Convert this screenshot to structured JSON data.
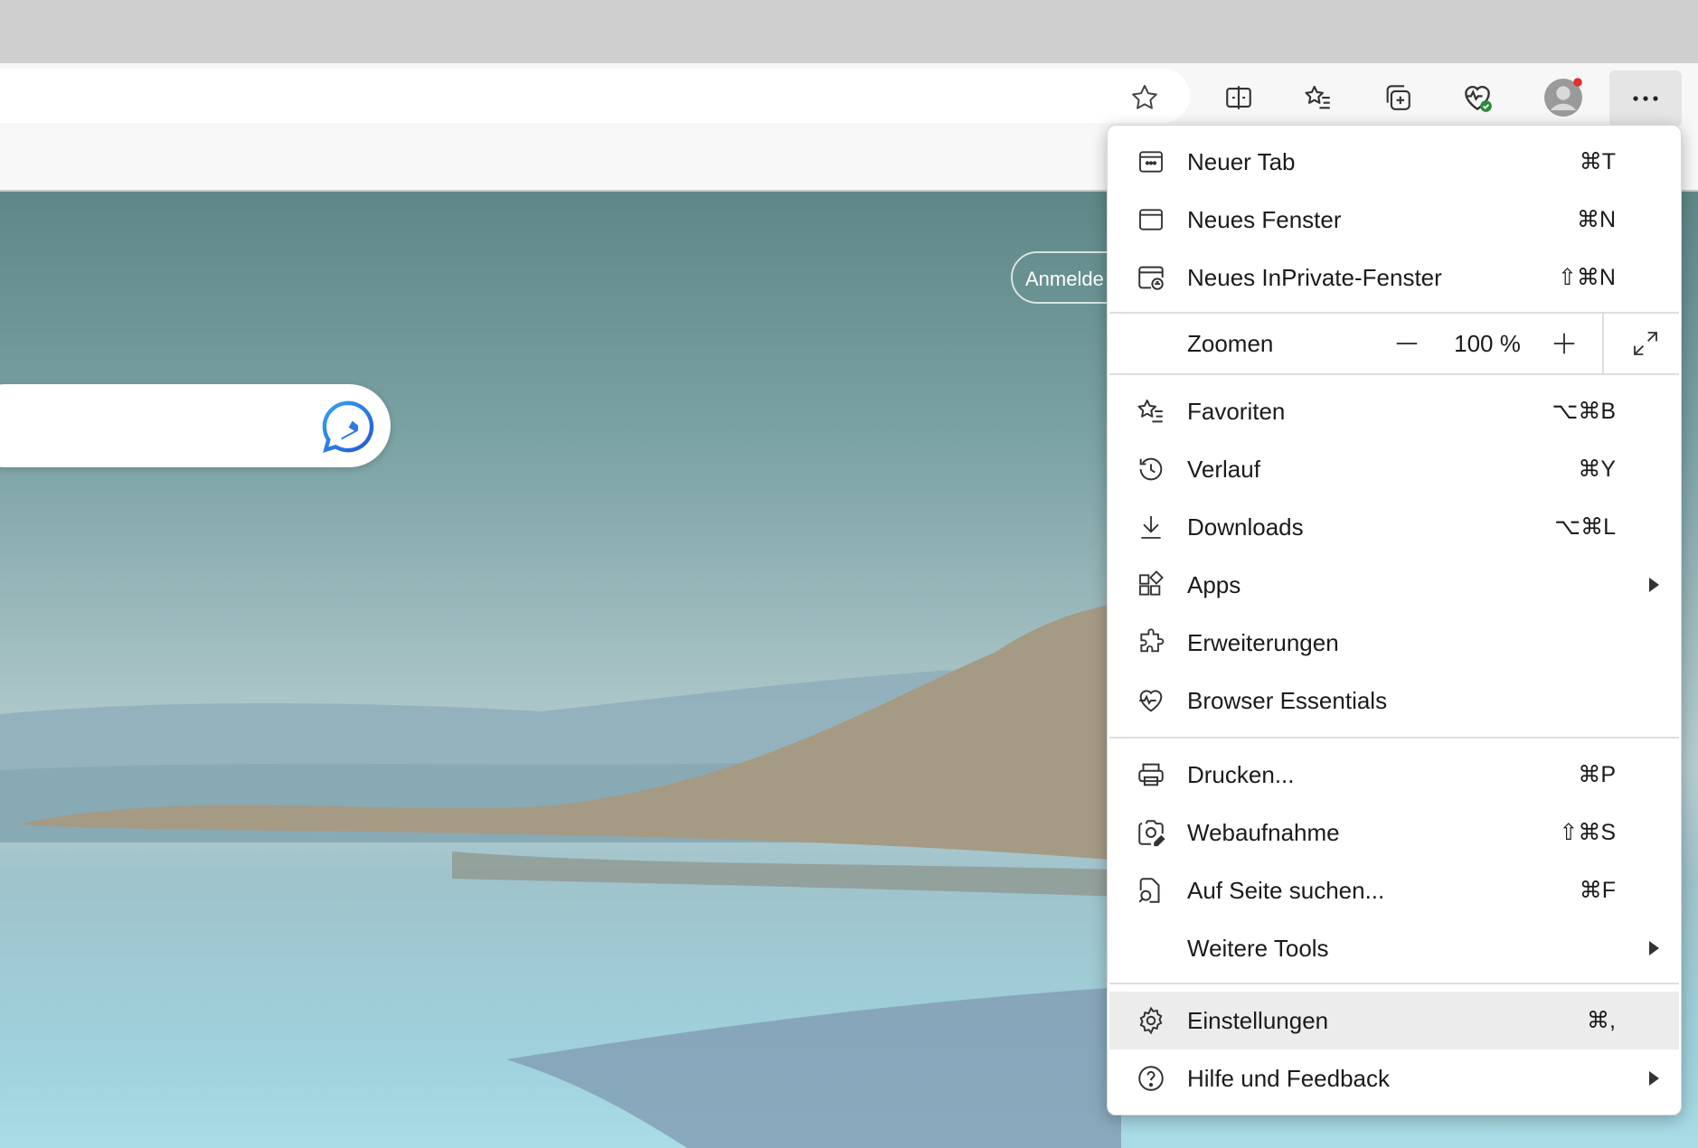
{
  "browser": {
    "toolbar_icons": [
      "split-screen-icon",
      "favorites-icon",
      "collections-icon",
      "browser-essentials-icon",
      "profile-avatar-icon",
      "more-options-icon"
    ],
    "address_bar_star": "add-favorite-star-icon"
  },
  "page": {
    "signin_label": "Anmelde",
    "bing_icon": "bing-chat-icon"
  },
  "menu": {
    "items": [
      {
        "label": "Neuer Tab",
        "shortcut": "⌘T",
        "icon": "new-tab-icon"
      },
      {
        "label": "Neues Fenster",
        "shortcut": "⌘N",
        "icon": "new-window-icon"
      },
      {
        "label": "Neues InPrivate-Fenster",
        "shortcut": "⇧⌘N",
        "icon": "inprivate-window-icon"
      },
      {
        "label": "Favoriten",
        "shortcut": "⌥⌘B",
        "icon": "favorites-icon"
      },
      {
        "label": "Verlauf",
        "shortcut": "⌘Y",
        "icon": "history-icon"
      },
      {
        "label": "Downloads",
        "shortcut": "⌥⌘L",
        "icon": "download-icon"
      },
      {
        "label": "Apps",
        "shortcut": "",
        "icon": "apps-icon"
      },
      {
        "label": "Erweiterungen",
        "shortcut": "",
        "icon": "extensions-icon"
      },
      {
        "label": "Browser Essentials",
        "shortcut": "",
        "icon": "heart-pulse-icon"
      },
      {
        "label": "Drucken...",
        "shortcut": "⌘P",
        "icon": "printer-icon"
      },
      {
        "label": "Webaufnahme",
        "shortcut": "⇧⌘S",
        "icon": "web-capture-icon"
      },
      {
        "label": "Auf Seite suchen...",
        "shortcut": "⌘F",
        "icon": "find-on-page-icon"
      },
      {
        "label": "Weitere Tools",
        "shortcut": "",
        "icon": ""
      },
      {
        "label": "Einstellungen",
        "shortcut": "⌘,",
        "icon": "gear-icon"
      },
      {
        "label": "Hilfe und Feedback",
        "shortcut": "",
        "icon": "help-icon"
      }
    ],
    "zoom": {
      "label": "Zoomen",
      "value": "100 %",
      "minus": "—",
      "plus": "+"
    }
  }
}
